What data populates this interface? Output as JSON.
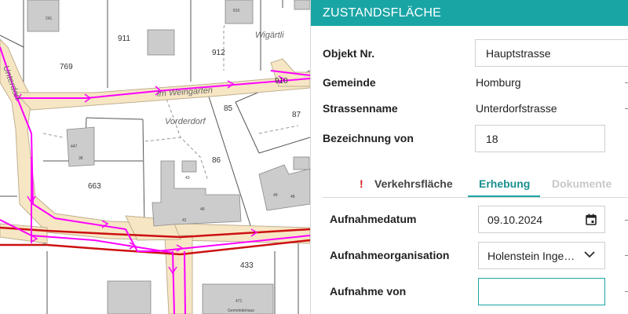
{
  "map": {
    "parcels": [
      "769",
      "911",
      "912",
      "910",
      "663",
      "86",
      "85",
      "87",
      "433",
      "241",
      "810",
      "447",
      "38",
      "43",
      "48",
      "49",
      "48",
      "29",
      "49",
      "471",
      "42",
      "9"
    ],
    "streets": [
      "Wigärtli",
      "Vorderdorf",
      "Im Weingarten",
      "Unterdorf"
    ],
    "building_note": "Gemeindehaus"
  },
  "panel": {
    "title": "ZUSTANDSFLÄCHE",
    "objekt_label": "Objekt Nr.",
    "objekt_value": "Hauptstrasse",
    "gemeinde_label": "Gemeinde",
    "gemeinde_value": "Homburg",
    "strassenname_label": "Strassenname",
    "strassenname_value": "Unterdorfstrasse",
    "bezeichnung_label": "Bezeichnung von",
    "bezeichnung_value": "18",
    "tabs": {
      "warn_mark": "!",
      "verkehrsflaeche": "Verkehrsfläche",
      "erhebung": "Erhebung",
      "dokumente": "Dokumente"
    },
    "aufnahmedatum_label": "Aufnahmedatum",
    "aufnahmedatum_value": "09.10.2024",
    "aufnahmeorg_label": "Aufnahmeorganisation",
    "aufnahmeorg_value": "Holenstein Inge…",
    "aufnahme_von_label": "Aufnahme von",
    "aufnahme_von_value": ""
  },
  "colors": {
    "accent": "#1aa5a5",
    "route_magenta": "#ff00ff",
    "route_red": "#cc1111",
    "road_fill": "#f7e6c4",
    "building_gray": "#cccccc",
    "warning": "#d01c1c"
  },
  "icons": [
    "calendar-icon",
    "chevron-down-icon",
    "warning-icon"
  ]
}
